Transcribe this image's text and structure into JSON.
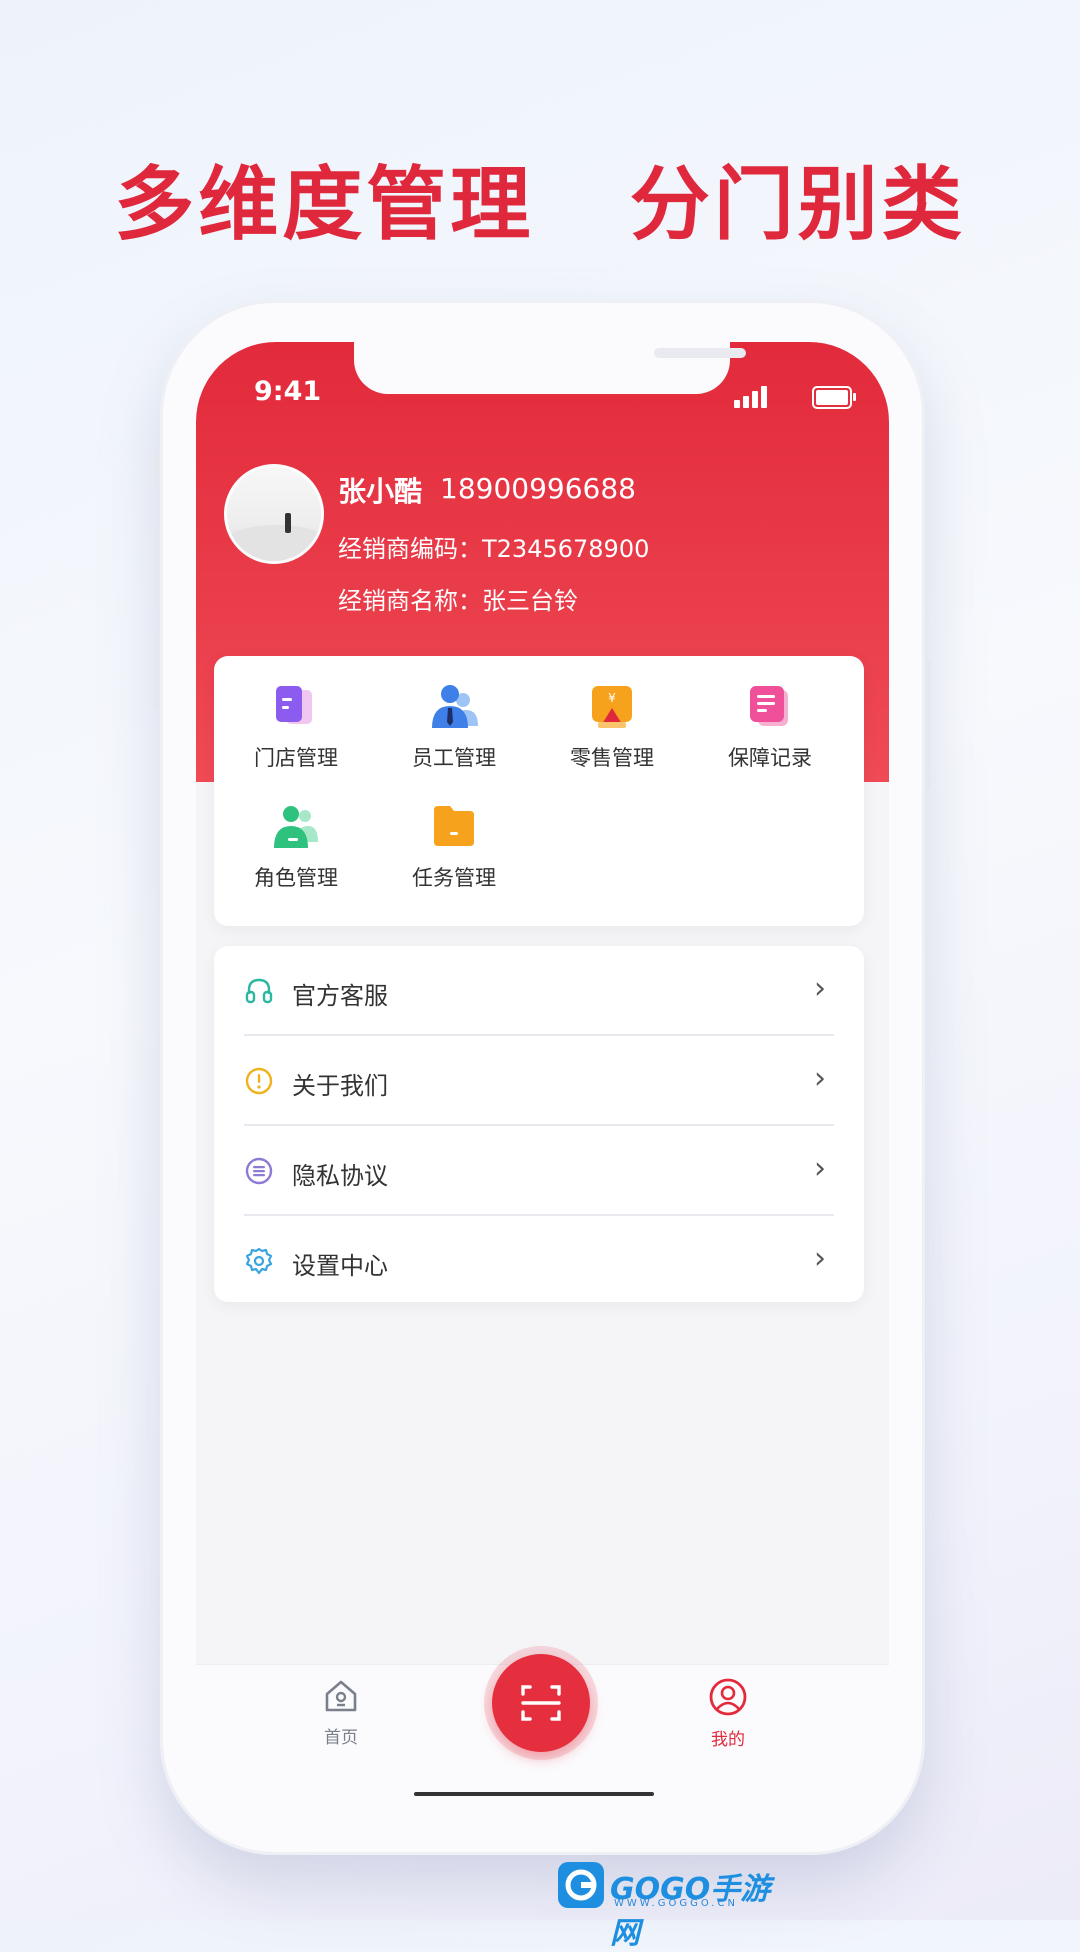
{
  "headline": {
    "left": "多维度管理",
    "right": "分门别类"
  },
  "status_bar": {
    "time": "9:41"
  },
  "profile": {
    "name": "张小酷",
    "phone": "18900996688",
    "dealer_code_label": "经销商编码：",
    "dealer_code": "T2345678900",
    "dealer_name_label": "经销商名称：",
    "dealer_name": "张三台铃"
  },
  "grid": {
    "items": [
      {
        "label": "门店管理",
        "icon": "store-icon",
        "color": "#8c5cf0"
      },
      {
        "label": "员工管理",
        "icon": "staff-icon",
        "color": "#3f7fe8"
      },
      {
        "label": "零售管理",
        "icon": "retail-icon",
        "color": "#f5a623"
      },
      {
        "label": "保障记录",
        "icon": "warranty-icon",
        "color": "#f0509a"
      },
      {
        "label": "角色管理",
        "icon": "role-icon",
        "color": "#2ec27e"
      },
      {
        "label": "任务管理",
        "icon": "task-icon",
        "color": "#f7a21c"
      }
    ]
  },
  "menu": {
    "items": [
      {
        "label": "官方客服",
        "icon": "headset-icon",
        "color": "#2bb8a0"
      },
      {
        "label": "关于我们",
        "icon": "info-icon",
        "color": "#f0b21a"
      },
      {
        "label": "隐私协议",
        "icon": "list-icon",
        "color": "#8e7ad6"
      },
      {
        "label": "设置中心",
        "icon": "gear-icon",
        "color": "#3aa4e0"
      }
    ],
    "chevron": "›"
  },
  "tabbar": {
    "home_label": "首页",
    "mine_label": "我的",
    "active_color": "#e22a3b",
    "inactive_color": "#7a7f8c"
  },
  "watermark": {
    "text": "GOGO手游网",
    "sub": "WWW.GOGGO.CN"
  }
}
